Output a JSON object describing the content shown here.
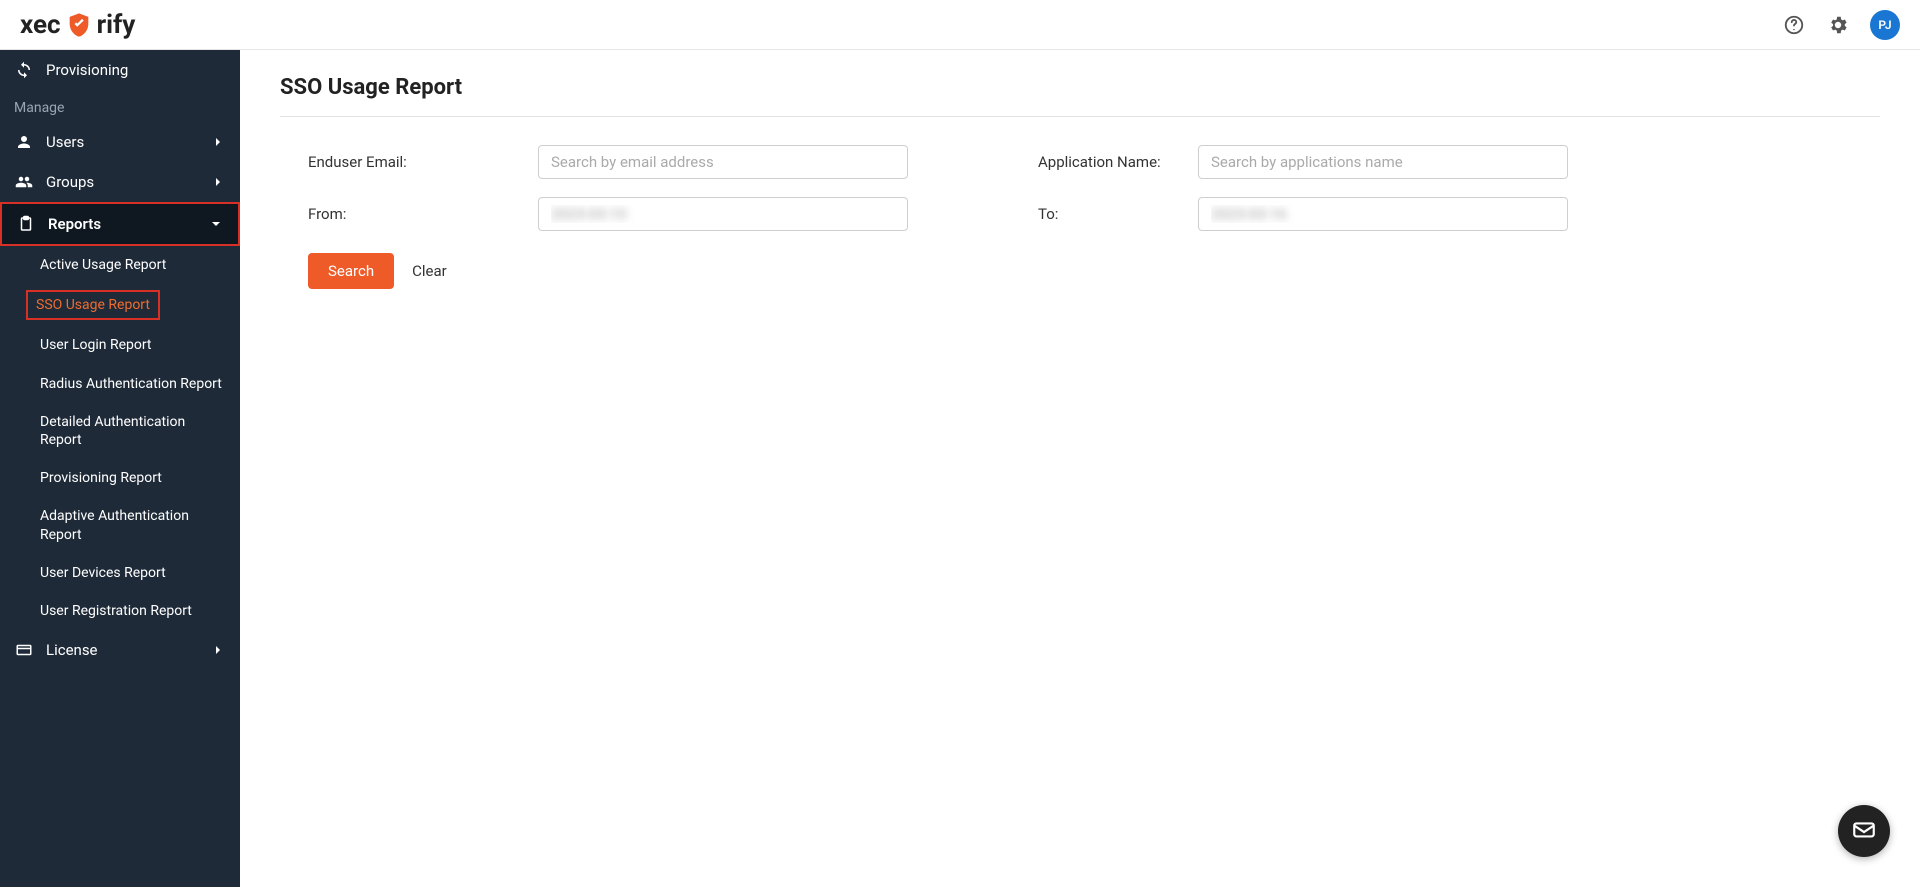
{
  "brand": {
    "name_left": "xec",
    "name_right": "rify"
  },
  "header": {
    "avatar_initials": "PJ"
  },
  "sidebar": {
    "top_item": {
      "label": "Provisioning"
    },
    "section_manage": "Manage",
    "users": {
      "label": "Users"
    },
    "groups": {
      "label": "Groups"
    },
    "reports": {
      "label": "Reports"
    },
    "report_items": [
      {
        "label": "Active Usage Report"
      },
      {
        "label": "SSO Usage Report"
      },
      {
        "label": "User Login Report"
      },
      {
        "label": "Radius Authentication Report"
      },
      {
        "label": "Detailed Authentication Report"
      },
      {
        "label": "Provisioning Report"
      },
      {
        "label": "Adaptive Authentication Report"
      },
      {
        "label": "User Devices Report"
      },
      {
        "label": "User Registration Report"
      }
    ],
    "license": {
      "label": "License"
    }
  },
  "page": {
    "title": "SSO Usage Report",
    "labels": {
      "email": "Enduser Email:",
      "app": "Application Name:",
      "from": "From:",
      "to": "To:"
    },
    "placeholders": {
      "email": "Search by email address",
      "app": "Search by applications name"
    },
    "values": {
      "from": "2023-03-10",
      "to": "2023-03-16"
    },
    "buttons": {
      "search": "Search",
      "clear": "Clear"
    }
  }
}
